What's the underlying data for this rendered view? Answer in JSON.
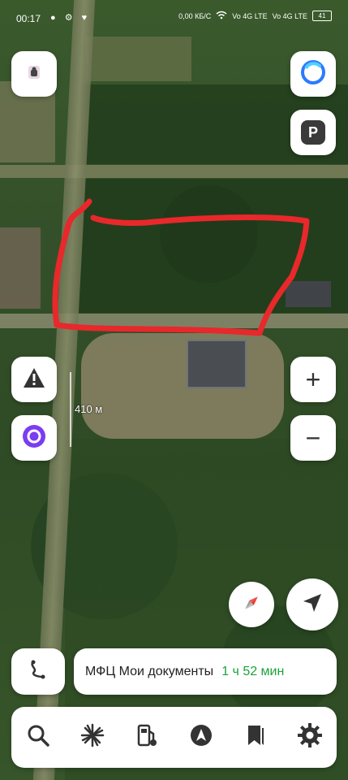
{
  "status_bar": {
    "time": "00:17",
    "left_icons": "● ⚙ ♥",
    "net_speed": "0,00\nКБ/С",
    "sim1": "Vo 4G LTE",
    "sim2": "Vo 4G LTE",
    "battery": "41"
  },
  "map": {
    "scale_label": "410 м",
    "overlay_color": "#e8282b"
  },
  "buttons": {
    "top_left": "profile-icon",
    "top_right_alice": "alice-icon",
    "parking": "P",
    "zoom_in": "+",
    "zoom_out": "−"
  },
  "route": {
    "name": "МФЦ Мои документы",
    "time": "1 ч 52 мин"
  },
  "tabbar": [
    "search-icon",
    "discover-icon",
    "fuel-icon",
    "navigator-icon",
    "bookmarks-icon",
    "settings-icon"
  ]
}
